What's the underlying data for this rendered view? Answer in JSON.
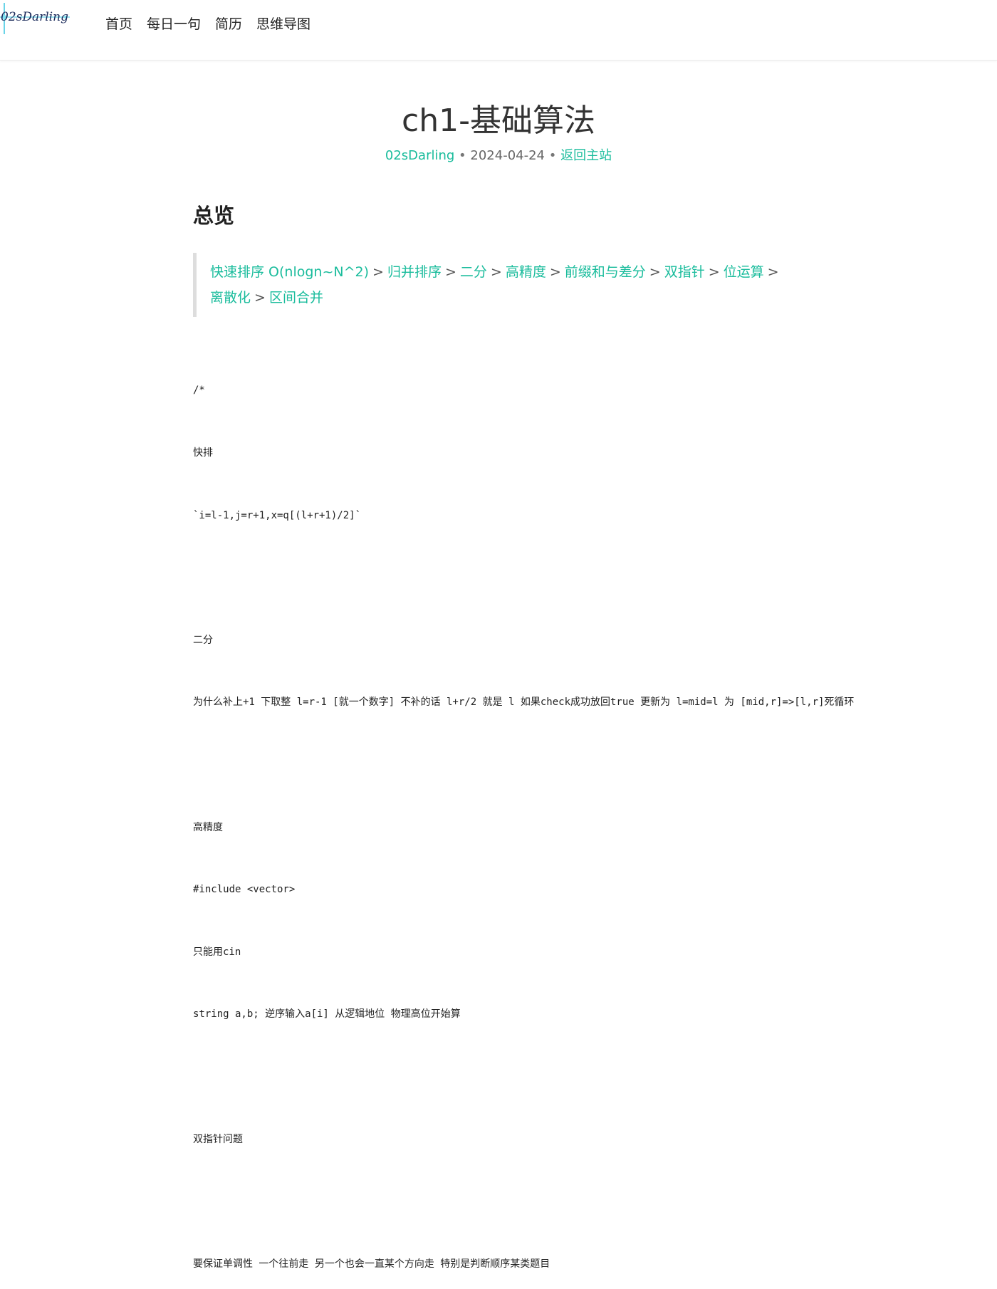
{
  "logo": {
    "text": "02sDarling"
  },
  "nav": {
    "items": [
      "首页",
      "每日一句",
      "简历",
      "思维导图"
    ]
  },
  "post": {
    "title": "ch1-基础算法",
    "author": "02sDarling",
    "date": "2024-04-24",
    "back_link": "返回主站",
    "meta_separator": "•"
  },
  "overview": {
    "heading": "总览",
    "toc_separator": ">",
    "toc_items": [
      "快速排序 O(nlogn~N^2)",
      "归并排序",
      "二分",
      "高精度",
      "前缀和与差分",
      "双指针",
      "位运算",
      "离散化",
      "区间合并"
    ]
  },
  "code_lines": [
    "/*",
    "快排",
    "`i=l-1,j=r+1,x=q[(l+r+1)/2]`",
    "",
    "二分",
    "为什么补上+1 下取整 l=r-1 [就一个数字] 不补的话 l+r/2 就是 l 如果check成功放回true 更新为 l=mid=l 为 [mid,r]=>[l,r]死循环",
    "",
    "高精度",
    "#include <vector>",
    "只能用cin",
    "string a,b; 逆序输入a[i] 从逻辑地位 物理高位开始算",
    "",
    "双指针问题",
    "",
    "要保证单调性 一个往前走 另一个也会一直某个方向走 特别是判断顺序某类题目"
  ],
  "colors": {
    "accent": "#1abc9c",
    "text": "#333333",
    "heading": "#222222",
    "quote_border": "#dddddd"
  }
}
